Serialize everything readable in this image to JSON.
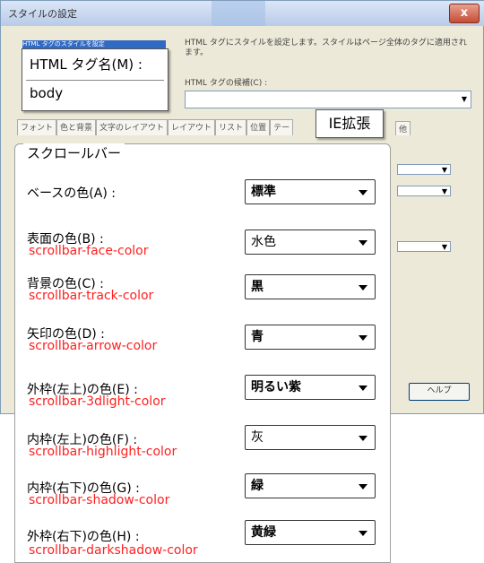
{
  "window": {
    "title": "スタイルの設定",
    "close_glyph": "x"
  },
  "description": "HTML タグにスタイルを設定します。スタイルはページ全体のタグに適用されます。",
  "tag_list_highlight": "HTML タグのスタイルを設定",
  "candidate": {
    "label": "HTML タグの候補(C) :",
    "value": ""
  },
  "tabs": [
    "フォント",
    "色と背景",
    "文字のレイアウト",
    "レイアウト",
    "リスト",
    "位置",
    "テー"
  ],
  "tab_extra": "他",
  "help_button": "ヘルプ",
  "tag_name_callout": {
    "label": "HTML タグ名(M) :",
    "value": "body"
  },
  "ie_callout": "IE拡張",
  "group_title": "スクロールバー",
  "rows": [
    {
      "label": "ベースの色(A) :",
      "css": "",
      "value": "標準"
    },
    {
      "label": "表面の色(B) :",
      "css": "scrollbar-face-color",
      "value": "水色"
    },
    {
      "label": "背景の色(C) :",
      "css": "scrollbar-track-color",
      "value": "黒"
    },
    {
      "label": "矢印の色(D) :",
      "css": "scrollbar-arrow-color",
      "value": "青"
    },
    {
      "label": "外枠(左上)の色(E) :",
      "css": "scrollbar-3dlight-color",
      "value": "明るい紫"
    },
    {
      "label": "内枠(左上)の色(F) :",
      "css": "scrollbar-highlight-color",
      "value": "灰"
    },
    {
      "label": "内枠(右下)の色(G) :",
      "css": "scrollbar-shadow-color",
      "value": "緑"
    },
    {
      "label": "外枠(右下)の色(H) :",
      "css": "scrollbar-darkshadow-color",
      "value": "黄緑"
    }
  ],
  "colors": {
    "css_name": "#ff2020",
    "dialog_bg": "#ece9d8"
  }
}
